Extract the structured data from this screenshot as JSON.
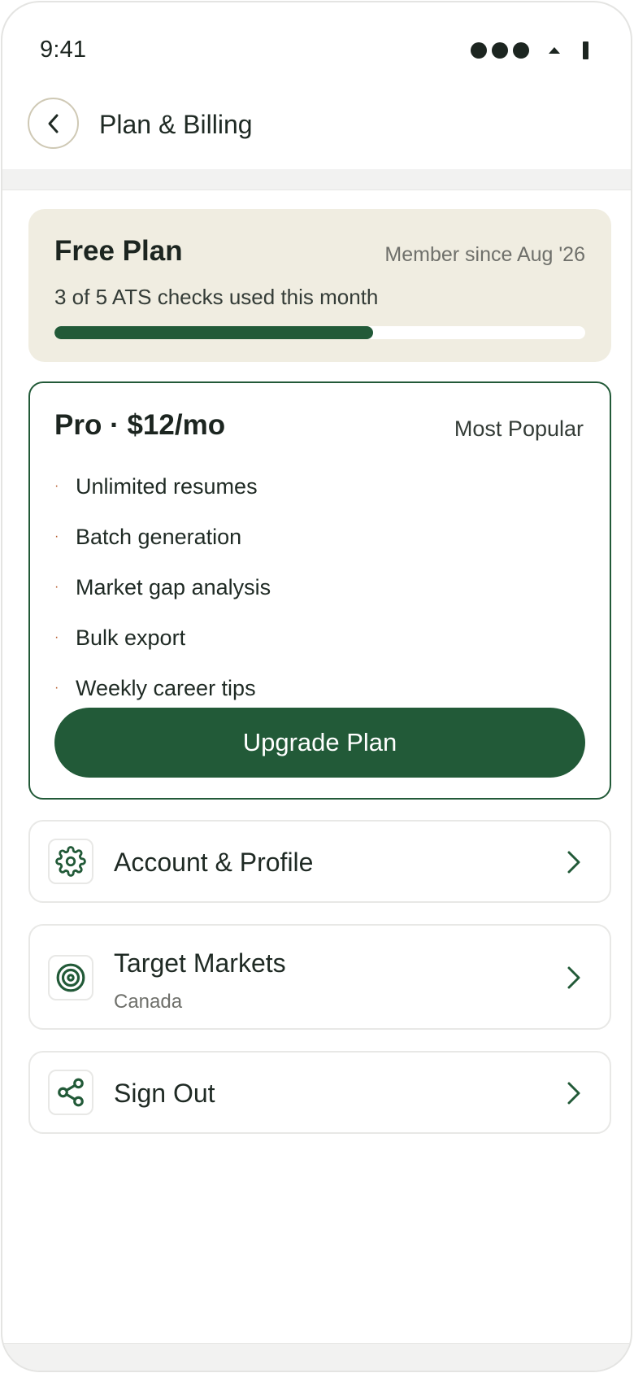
{
  "status_bar": {
    "time": "9:41"
  },
  "header": {
    "title": "Plan & Billing",
    "back_icon": "chevron-left-icon"
  },
  "current_plan": {
    "title": "Free Plan",
    "member_since": "Member since Aug '26",
    "usage_text": "3 of 5 ATS checks used this month",
    "usage_used": 3,
    "usage_limit": 5
  },
  "pro_plan": {
    "title": "Pro · $12/mo",
    "badge": "Most Popular",
    "bullet": "·",
    "features": [
      "Unlimited resumes",
      "Batch generation",
      "Market gap analysis",
      "Bulk export",
      "Weekly career tips"
    ],
    "cta": "Upgrade Plan"
  },
  "menu": [
    {
      "label": "Account & Profile",
      "icon": "gear-icon"
    },
    {
      "label": "Target Markets",
      "sublabel": "Canada",
      "icon": "target-icon"
    },
    {
      "label": "Sign Out",
      "icon": "share-icon"
    }
  ],
  "colors": {
    "brand": "#225a38",
    "card_beige": "#f0ede1",
    "bullet": "#b85c2e",
    "muted_text": "#6f706b"
  }
}
